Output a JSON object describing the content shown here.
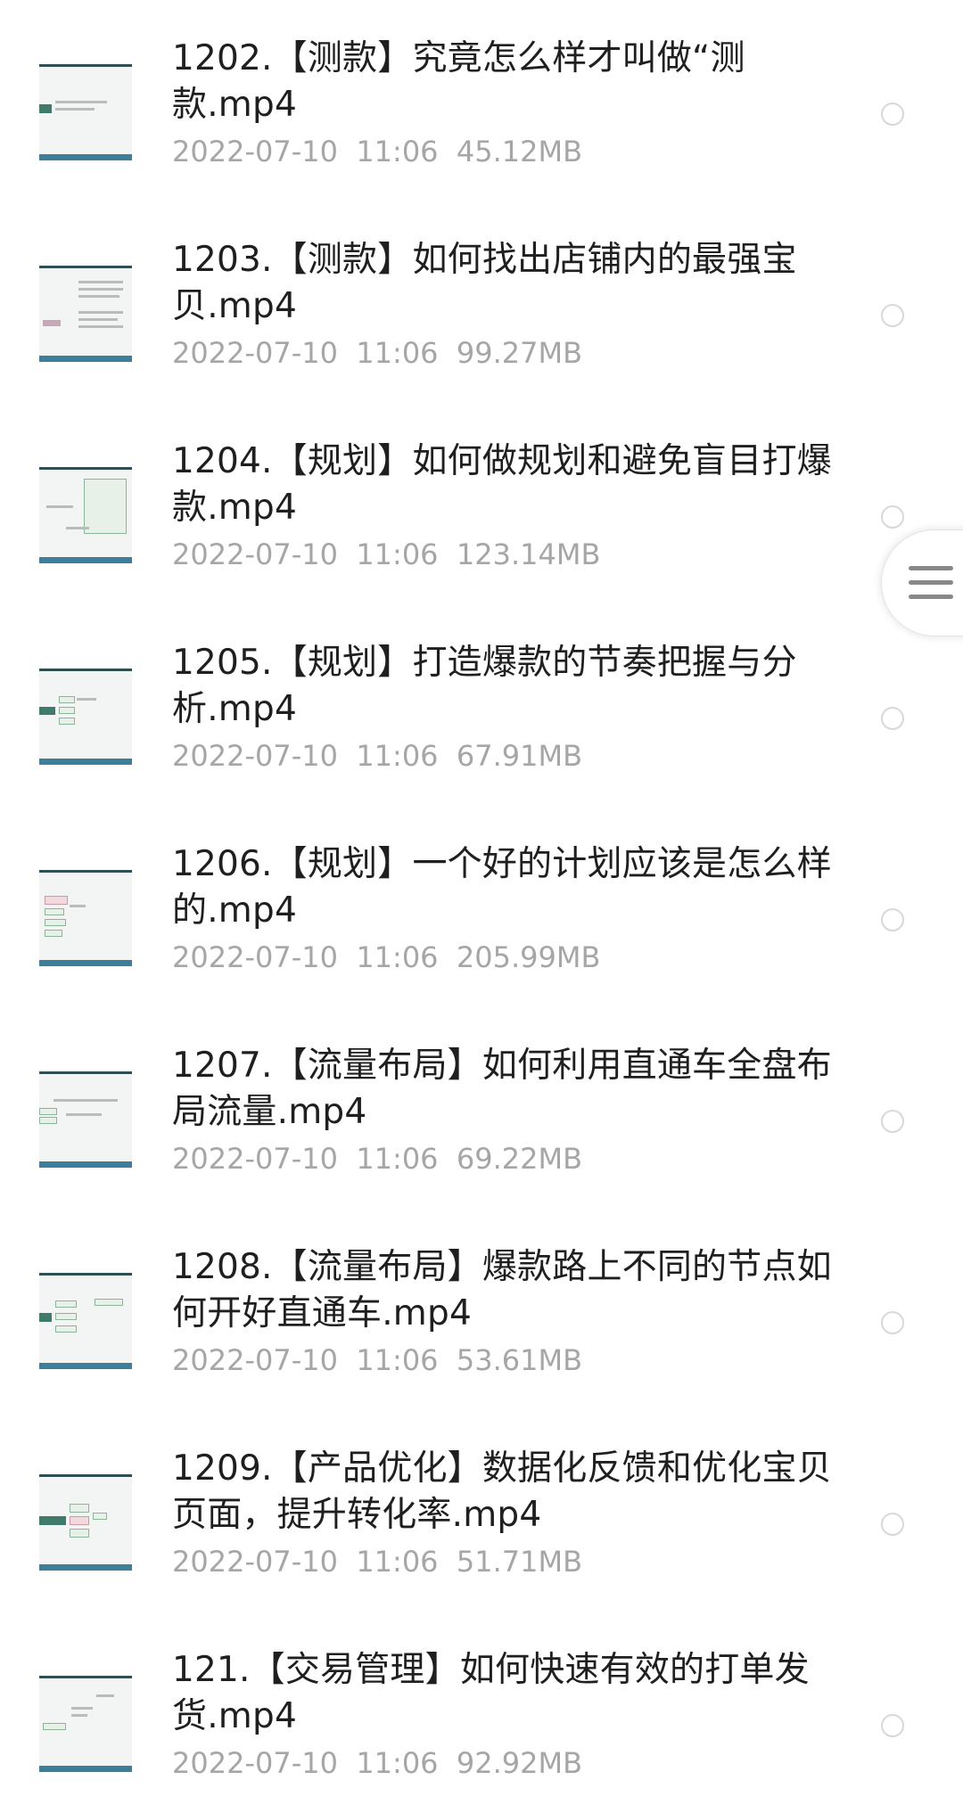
{
  "files": [
    {
      "title": "1202.【测款】究竟怎么样才叫做“测款.mp4",
      "date": "2022-07-10",
      "time": "11:06",
      "size": "45.12MB"
    },
    {
      "title": "1203.【测款】如何找出店铺内的最强宝贝.mp4",
      "date": "2022-07-10",
      "time": "11:06",
      "size": "99.27MB"
    },
    {
      "title": "1204.【规划】如何做规划和避免盲目打爆款.mp4",
      "date": "2022-07-10",
      "time": "11:06",
      "size": "123.14MB"
    },
    {
      "title": "1205.【规划】打造爆款的节奏把握与分析.mp4",
      "date": "2022-07-10",
      "time": "11:06",
      "size": "67.91MB"
    },
    {
      "title": "1206.【规划】一个好的计划应该是怎么样的.mp4",
      "date": "2022-07-10",
      "time": "11:06",
      "size": "205.99MB"
    },
    {
      "title": "1207.【流量布局】如何利用直通车全盘布局流量.mp4",
      "date": "2022-07-10",
      "time": "11:06",
      "size": "69.22MB"
    },
    {
      "title": "1208.【流量布局】爆款路上不同的节点如何开好直通车.mp4",
      "date": "2022-07-10",
      "time": "11:06",
      "size": "53.61MB"
    },
    {
      "title": "1209.【产品优化】数据化反馈和优化宝贝页面，提升转化率.mp4",
      "date": "2022-07-10",
      "time": "11:06",
      "size": "51.71MB"
    },
    {
      "title": "121.【交易管理】如何快速有效的打单发货.mp4",
      "date": "2022-07-10",
      "time": "11:06",
      "size": "92.92MB"
    }
  ],
  "floating_button": {
    "icon": "hamburger-menu-icon"
  }
}
